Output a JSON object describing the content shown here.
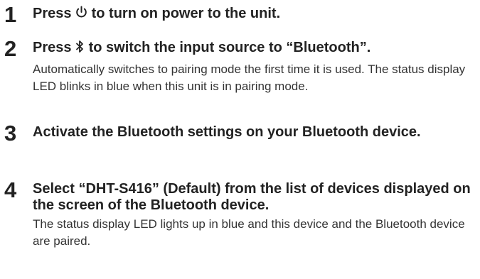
{
  "steps": [
    {
      "number": "1",
      "title_before": "Press ",
      "title_icon": "power-icon",
      "title_after": " to turn on power to the unit."
    },
    {
      "number": "2",
      "title_before": "Press ",
      "title_icon": "bluetooth-icon",
      "title_after": " to switch the input source to “Bluetooth”.",
      "description": "Automatically switches to pairing mode the first time it is used. The status display LED blinks in blue when this unit is in pairing mode."
    },
    {
      "number": "3",
      "title": "Activate the Bluetooth settings on your Bluetooth device."
    },
    {
      "number": "4",
      "title": "Select “DHT-S416” (Default) from the list of devices displayed on the screen of the Bluetooth device.",
      "description": "The status display LED lights up in blue and this device and the Bluetooth device are paired."
    }
  ]
}
